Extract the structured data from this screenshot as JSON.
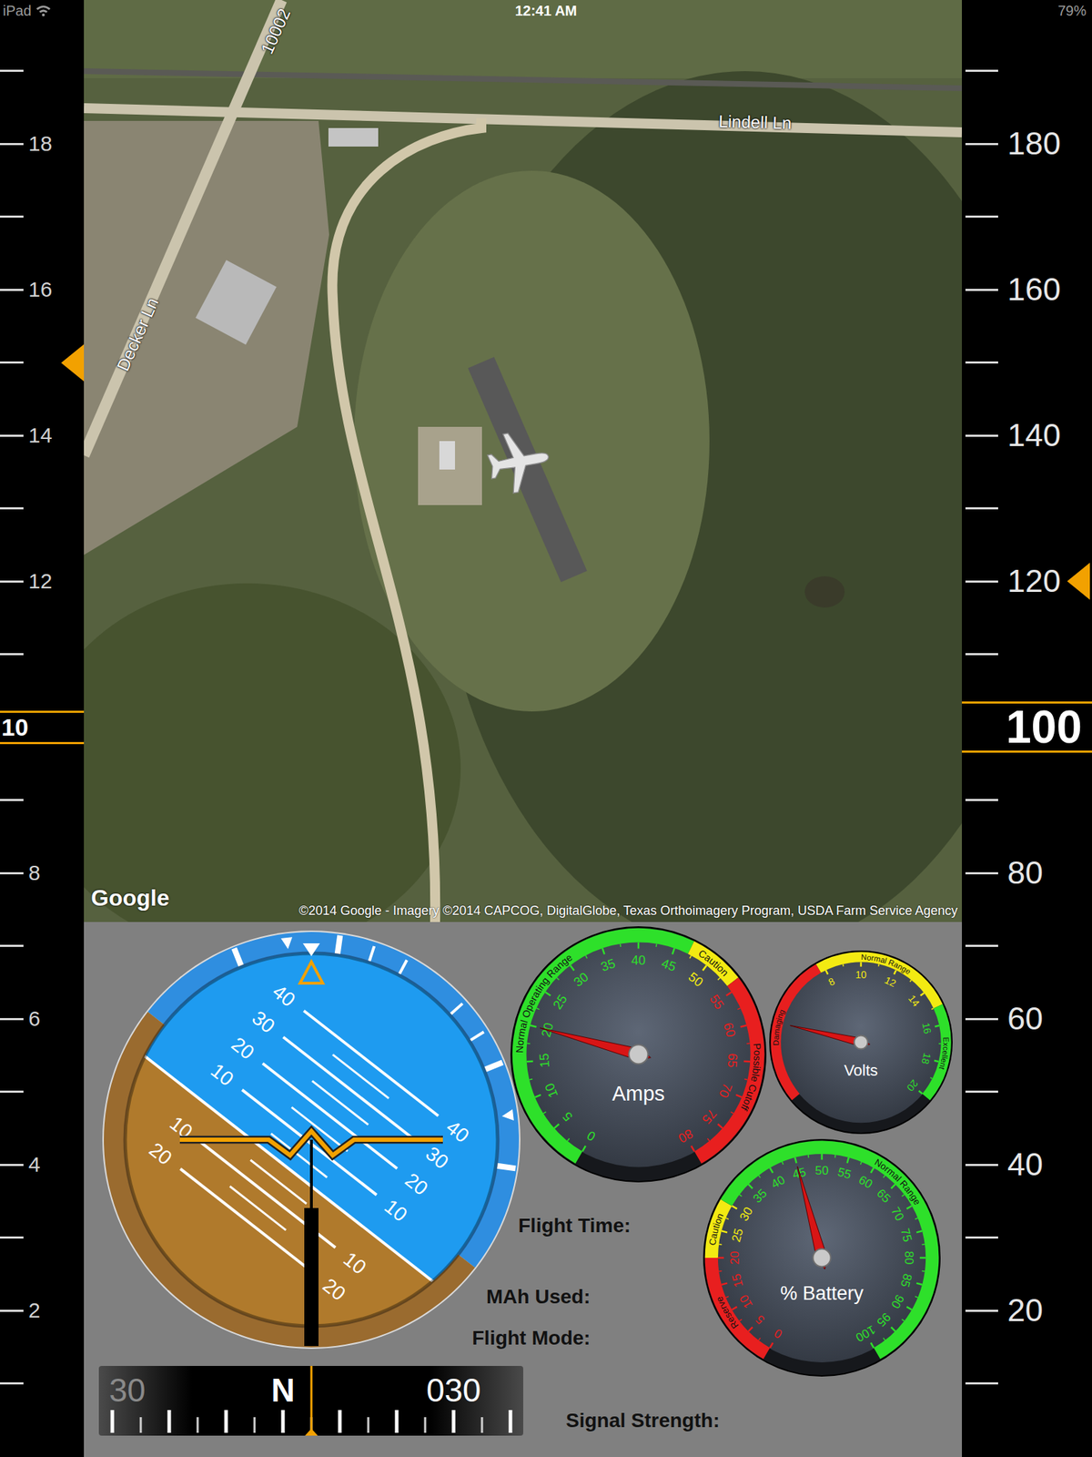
{
  "status_bar": {
    "carrier": "iPad",
    "time": "12:41 AM",
    "battery": "79%"
  },
  "altitude_tape": {
    "labels": [
      "18",
      "16",
      "14",
      "12",
      "8",
      "6",
      "4",
      "2"
    ],
    "current": "10",
    "bug_value": 15
  },
  "speed_tape": {
    "labels": [
      "180",
      "160",
      "140",
      "120",
      "80",
      "60",
      "40",
      "20"
    ],
    "current": "100",
    "bug_value": 120
  },
  "map": {
    "road_labels": [
      "Lindell Ln",
      "Decker Ln",
      "10002"
    ],
    "logo": "Google",
    "attribution": "©2014 Google - Imagery ©2014 CAPCOG, DigitalGlobe, Texas Orthoimagery Program, USDA Farm Service Agency"
  },
  "attitude": {
    "roll_deg": 38,
    "pitch_deg": 11,
    "sky_ladder": [
      "10",
      "20",
      "30",
      "40"
    ],
    "ground_ladder": [
      "10",
      "20"
    ]
  },
  "gauges": [
    {
      "title": "Amps",
      "level": 0.25,
      "labels": [
        "0",
        "5",
        "10",
        "15",
        "20",
        "25",
        "30",
        "35",
        "40",
        "45",
        "50",
        "55",
        "60",
        "65",
        "70",
        "75",
        "80"
      ],
      "bands": [
        {
          "label": "Normal Operating Range",
          "color": "#2ee02a",
          "level": 0.5875
        },
        {
          "label": "Caution",
          "color": "#f3ea12",
          "level": 0.675
        },
        {
          "label": "Possible Cutoff",
          "color": "#e81f1f",
          "level": 1
        }
      ]
    },
    {
      "title": "Volts",
      "level": 0.205,
      "labels": [
        "8",
        "10",
        "12",
        "14",
        "16",
        "18",
        "20"
      ],
      "bands": [
        {
          "label": "Damaging",
          "color": "#e81f1f",
          "level": 0.385
        },
        {
          "label": "Normal Range",
          "color": "#f3ea12",
          "level": 0.75
        },
        {
          "label": "Excellent",
          "color": "#2ee02a",
          "level": 1
        }
      ]
    },
    {
      "title": "% Battery",
      "level": 0.45,
      "labels": [
        "0",
        "5",
        "10",
        "15",
        "20",
        "25",
        "30",
        "35",
        "40",
        "45",
        "50",
        "55",
        "60",
        "65",
        "70",
        "75",
        "80",
        "85",
        "90",
        "95",
        "100"
      ],
      "bands": [
        {
          "label": "Reserve",
          "color": "#e81f1f",
          "level": 0.2
        },
        {
          "label": "Caution",
          "color": "#f3ea12",
          "level": 0.3
        },
        {
          "label": "Normal Range",
          "color": "#2ee02a",
          "level": 1
        }
      ]
    }
  ],
  "info_labels": [
    "Flight Time:",
    "MAh Used:",
    "Flight Mode:",
    "Signal Strength:"
  ],
  "compass": {
    "heading_deg": 5,
    "labels": [
      "30",
      "N",
      "030"
    ]
  }
}
